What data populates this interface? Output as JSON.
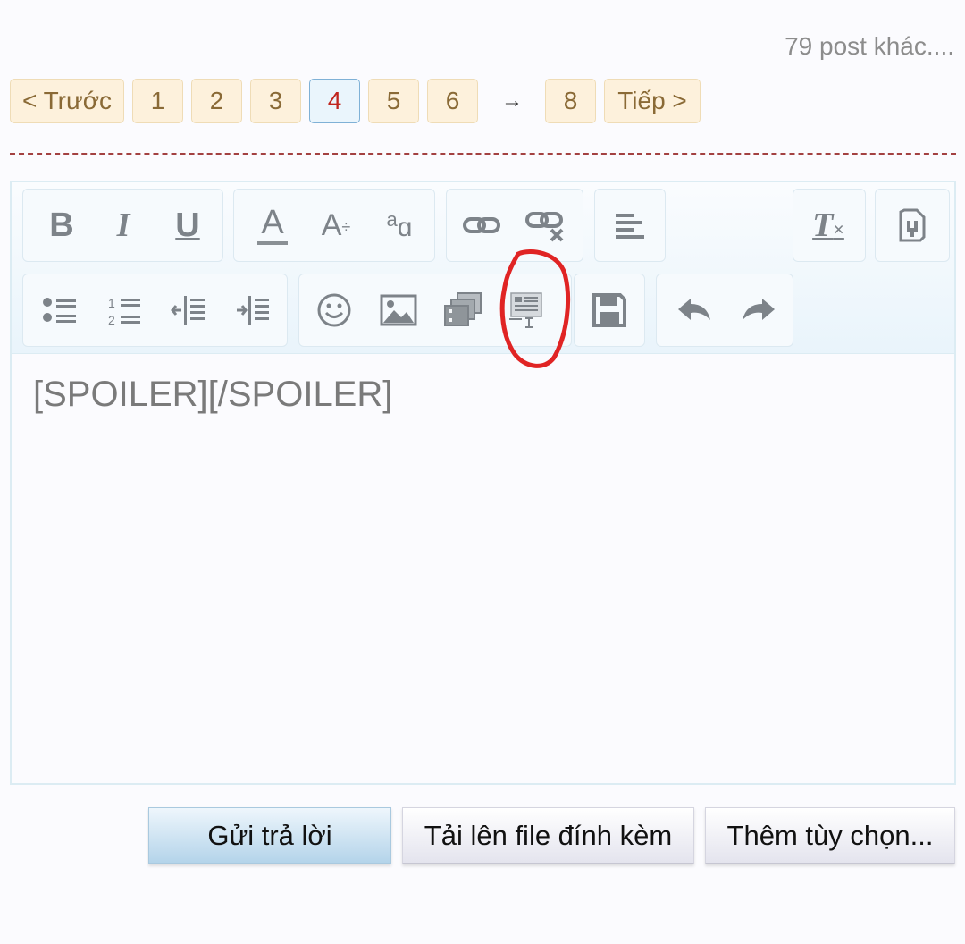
{
  "more_posts": "79 post khác....",
  "pagination": {
    "prev_label": "< Trước",
    "pages": [
      "1",
      "2",
      "3",
      "4",
      "5",
      "6"
    ],
    "current_page": "4",
    "ellipsis_arrow": "→",
    "last_page": "8",
    "next_label": "Tiếp >"
  },
  "toolbar": {
    "icons": [
      "bold-icon",
      "italic-icon",
      "underline-icon",
      "text-color-icon",
      "font-size-icon",
      "font-family-icon",
      "link-icon",
      "unlink-icon",
      "align-icon",
      "remove-format-icon",
      "bbcode-toggle-icon",
      "bullet-list-icon",
      "numbered-list-icon",
      "outdent-icon",
      "indent-icon",
      "smiley-icon",
      "image-icon",
      "media-icon",
      "spoiler-icon",
      "save-draft-icon",
      "undo-icon",
      "redo-icon"
    ],
    "bold_glyph": "B",
    "italic_glyph": "I",
    "underline_glyph": "U",
    "text_color_glyph": "A",
    "font_size_glyph": "A",
    "font_size_sub": "÷",
    "font_family_glyph": "a",
    "font_family_sub": "ɑ",
    "remove_format_glyph": "T",
    "annotation_color": "#e02424"
  },
  "editor": {
    "content": "[SPOILER][/SPOILER]"
  },
  "actions": {
    "submit_label": "Gửi trả lời",
    "upload_label": "Tải lên file đính kèm",
    "more_options_label": "Thêm tùy chọn..."
  }
}
